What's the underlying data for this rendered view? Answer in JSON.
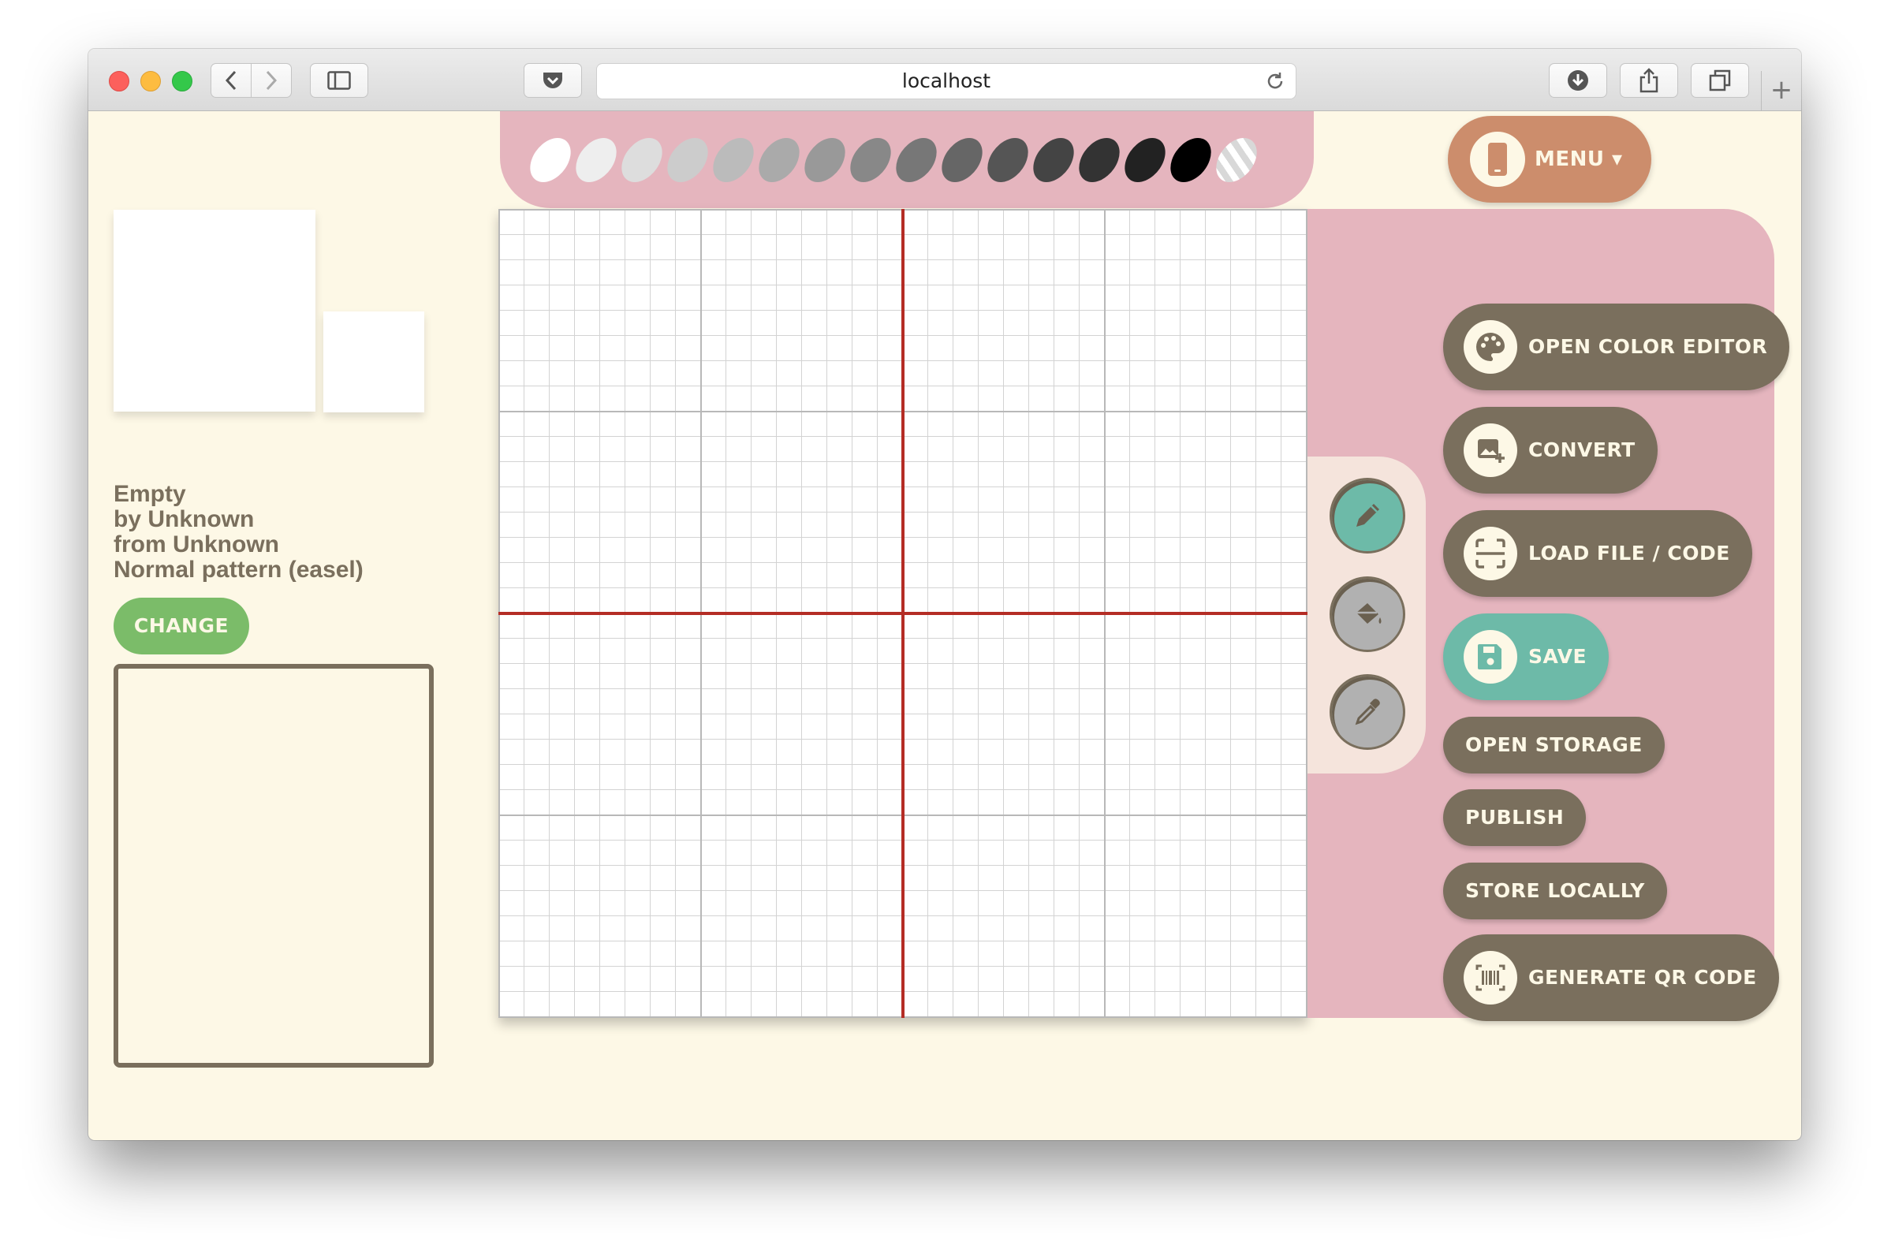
{
  "browser": {
    "url": "localhost",
    "new_tab_label": "+"
  },
  "palette": {
    "swatches": [
      "#ffffff",
      "#eeeeee",
      "#dddddd",
      "#cccccc",
      "#bbbbbb",
      "#aaaaaa",
      "#999999",
      "#888888",
      "#777777",
      "#666666",
      "#555555",
      "#444444",
      "#333333",
      "#222222",
      "#000000"
    ],
    "transparent_swatch": "striped"
  },
  "menu": {
    "label": "MENU ▾",
    "icon": "phone-icon",
    "color": "#cc8d6c"
  },
  "pattern_info": {
    "name": "Empty",
    "author": "by Unknown",
    "town": "from Unknown",
    "type": "Normal pattern (easel)"
  },
  "change_button": {
    "label": "CHANGE",
    "color": "#7bbc69"
  },
  "tools": [
    {
      "name": "pencil",
      "icon": "pencil-icon",
      "active": true
    },
    {
      "name": "fill",
      "icon": "paint-bucket-icon",
      "active": false
    },
    {
      "name": "color-picker",
      "icon": "eyedropper-icon",
      "active": false
    }
  ],
  "actions": {
    "open_color_editor": "OPEN COLOR EDITOR",
    "convert": "CONVERT",
    "load_file_code": "LOAD FILE / CODE",
    "save": "SAVE",
    "open_storage": "OPEN STORAGE",
    "publish": "PUBLISH",
    "store_locally": "STORE LOCALLY",
    "generate_qr_code": "GENERATE QR CODE"
  },
  "colors": {
    "page_bg": "#fdf8e6",
    "panel_pink": "#e5b5be",
    "button_brown": "#7a6f5d",
    "accent_teal": "#6dbaa8",
    "grid_center_line": "#b42d25"
  }
}
